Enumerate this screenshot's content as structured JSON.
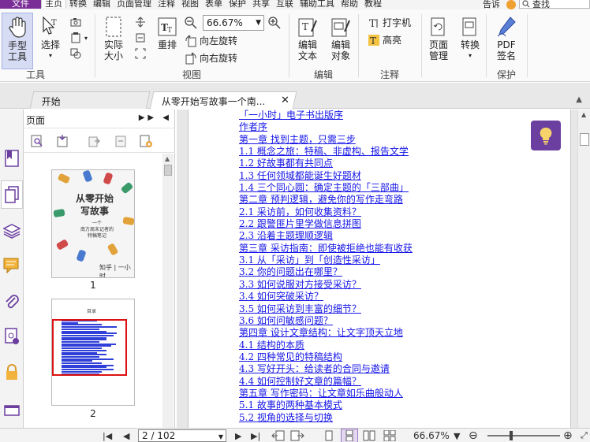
{
  "menu": {
    "file": "文件",
    "items": [
      "主页",
      "转换",
      "编辑",
      "页面管理",
      "注释",
      "视图",
      "表单",
      "保护",
      "共享",
      "互联",
      "辅助工具",
      "帮助",
      "教程"
    ],
    "active_index": 0,
    "tell_me": "告诉",
    "search_placeholder": "查找"
  },
  "ribbon": {
    "tools": {
      "hand": "手型\n工具",
      "select": "选择",
      "group_label": "工具"
    },
    "view": {
      "actual_size": "实际\n大小",
      "reflow": "重排",
      "zoom_value": "66.67%",
      "rotate_left": "向左旋转",
      "rotate_right": "向右旋转",
      "group_label": "视图"
    },
    "edit": {
      "edit_text": "编辑\n文本",
      "edit_object": "编辑\n对象",
      "group_label": "编辑"
    },
    "annotate": {
      "typewriter": "打字机",
      "highlight": "高亮",
      "group_label": "注释"
    },
    "pages": {
      "page_manage": "页面\n管理",
      "convert": "转换"
    },
    "protect": {
      "pdf_sign": "PDF\n签名",
      "group_label": "保护"
    }
  },
  "tabs": [
    {
      "label": "开始",
      "active": false
    },
    {
      "label": "从零开始写故事一个南...",
      "active": true
    }
  ],
  "thumb_panel": {
    "title": "页面",
    "pages": [
      {
        "number": "1",
        "cover_title": "从零开始\n写故事",
        "cover_sub": "一个\n南方周末记者的\n特稿笔记",
        "cover_brand": "知乎 | 一小时"
      },
      {
        "number": "2",
        "toc_title": "目录"
      }
    ]
  },
  "toc": [
    "「一小时」电子书出版序",
    "作者序",
    "第一章 找到主题，只需三步",
    "1.1 概念之旅：特稿、非虚构、报告文学",
    "1.2 好故事都有共同点",
    "1.3 任何领域都能诞生好题材",
    "1.4 三个同心圆：确定主题的「三部曲」",
    "第二章 预判逻辑，避免你的写作走弯路",
    "2.1 采访前，如何收集资料？",
    "2.2 跟警匪片里学做信息拼图",
    "2.3 沿着主题理顺逻辑",
    "第三章 采访指南：即使被拒绝也能有收获",
    "3.1 从「采访」到「创造性采访」",
    "3.2 你的问题出在哪里？",
    "3.3 如何说服对方接受采访？",
    "3.4 如何突破采访？",
    "3.5 如何采访到丰富的细节？",
    "3.6 如何问敏感问题？",
    "第四章 设计文章结构：让文字顶天立地",
    "4.1 结构的本质",
    "4.2 四种常见的特稿结构",
    "4.3 写好开头：给读者的合同与邀请",
    "4.4 如何控制好文章的篇幅？",
    "第五章 写作密码：让文章如乐曲般动人",
    "5.1 故事的两种基本模式",
    "5.2 视角的选择与切换"
  ],
  "status": {
    "page_display": "2 / 102",
    "zoom": "66.67%"
  },
  "colors": {
    "accent": "#7a2d96",
    "link": "#1515e8",
    "highlight_box": "#d11111"
  }
}
